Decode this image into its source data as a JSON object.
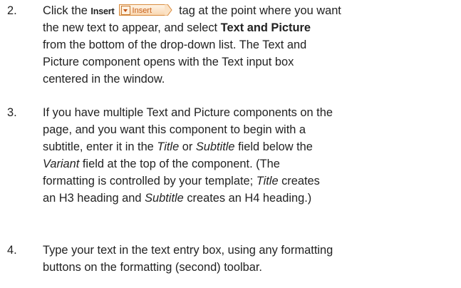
{
  "steps": [
    {
      "number": "2.",
      "lines": [
        {
          "pre": "Click the ",
          "cmd": "Insert",
          "tag_label": "Insert",
          "post": " tag at the point where you want"
        },
        [
          "the new text to appear, and select ",
          {
            "b": "Text and Picture"
          }
        ],
        [
          "from the bottom of the drop-down list. The Text and"
        ],
        [
          "Picture component opens with the Text input box"
        ],
        [
          "centered in the window."
        ]
      ]
    },
    {
      "number": "3.",
      "lines": [
        [
          "If you have multiple Text and Picture components on the"
        ],
        [
          "page, and you want this component to begin with a"
        ],
        [
          "subtitle, enter it in the ",
          {
            "i": "Title"
          },
          " or ",
          {
            "i": "Subtitle"
          },
          " field below the"
        ],
        [
          {
            "i": "Variant"
          },
          " field at the top of the component. (The"
        ],
        [
          "formatting is controlled by your template; ",
          {
            "i": "Title"
          },
          " creates"
        ],
        [
          "an H3 heading and ",
          {
            "i": "Subtitle"
          },
          " creates an H4 heading.)"
        ]
      ]
    },
    {
      "number": "4.",
      "lines": [
        [
          "Type your text in the text entry box, using any formatting"
        ],
        [
          "buttons on the formatting (second) toolbar."
        ]
      ]
    }
  ]
}
